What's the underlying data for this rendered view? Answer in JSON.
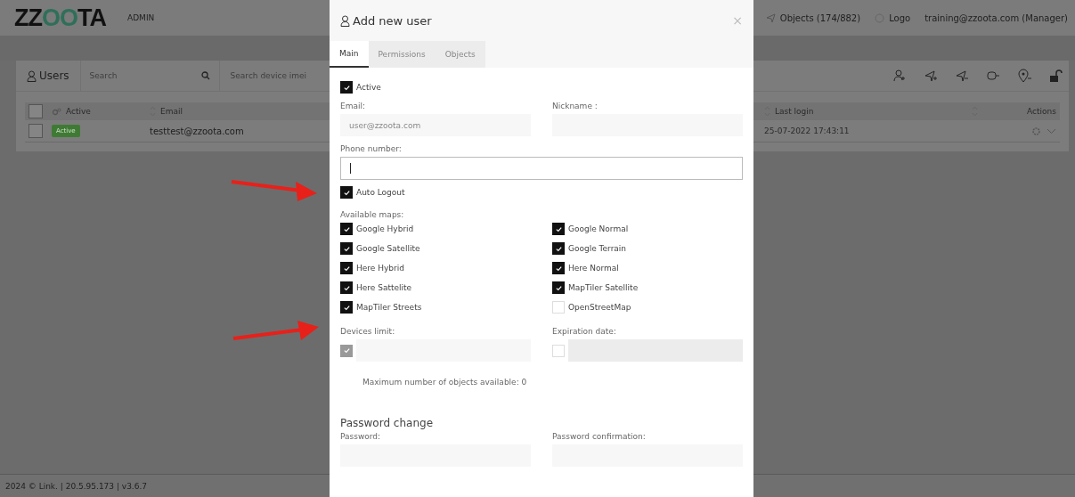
{
  "header": {
    "logo": "ZZOOTA",
    "section": "ADMIN",
    "objects": "Objects (174/882)",
    "logo_link": "Logo",
    "account": "training@zzoota.com (Manager)"
  },
  "users_panel": {
    "title": "Users",
    "search": {
      "placeholder": "Search"
    },
    "imei_search": {
      "placeholder": "Search device imei"
    },
    "table": {
      "select_all": false,
      "columns": [
        "Active",
        "Email",
        "Last login",
        "Actions"
      ],
      "rows": [
        {
          "selected": false,
          "status": "Active",
          "email": "testtest@zzoota.com",
          "last_login": "25-07-2022 17:43:11"
        }
      ]
    }
  },
  "footer": "2024 © Link. | 20.5.95.173 | v3.6.7",
  "dialog": {
    "title": "Add new user",
    "close": "×",
    "tabs": [
      {
        "label": "Main",
        "selected": true
      },
      {
        "label": "Permissions",
        "selected": false
      },
      {
        "label": "Objects",
        "selected": false
      }
    ],
    "active": {
      "label": "Active",
      "checked": true
    },
    "email": {
      "label": "Email:",
      "placeholder": "user@zzoota.com"
    },
    "nickname": {
      "label": "Nickname :"
    },
    "phone": {
      "label": "Phone number:",
      "focused": true
    },
    "auto_logout": {
      "label": "Auto Logout",
      "checked": true
    },
    "maps": {
      "label": "Available maps:",
      "items": [
        {
          "label": "Google Hybrid",
          "checked": true
        },
        {
          "label": "Google Normal",
          "checked": true
        },
        {
          "label": "Google Satellite",
          "checked": true
        },
        {
          "label": "Google Terrain",
          "checked": true
        },
        {
          "label": "Here Hybrid",
          "checked": true
        },
        {
          "label": "Here Normal",
          "checked": true
        },
        {
          "label": "Here Sattelite",
          "checked": true
        },
        {
          "label": "MapTiler Satellite",
          "checked": true
        },
        {
          "label": "MapTiler Streets",
          "checked": true
        },
        {
          "label": "OpenStreetMap",
          "checked": false
        }
      ]
    },
    "devices_limit": {
      "label": "Devices limit:",
      "checked": true,
      "disabled": true
    },
    "expiration": {
      "label": "Expiration date:",
      "checked": false
    },
    "max_objects_note": "Maximum number of objects available: 0",
    "password_section": {
      "title": "Password change",
      "password": {
        "label": "Password:"
      },
      "confirmation": {
        "label": "Password confirmation:"
      }
    }
  },
  "annotations": [
    {
      "kind": "arrow"
    },
    {
      "kind": "arrow"
    }
  ]
}
